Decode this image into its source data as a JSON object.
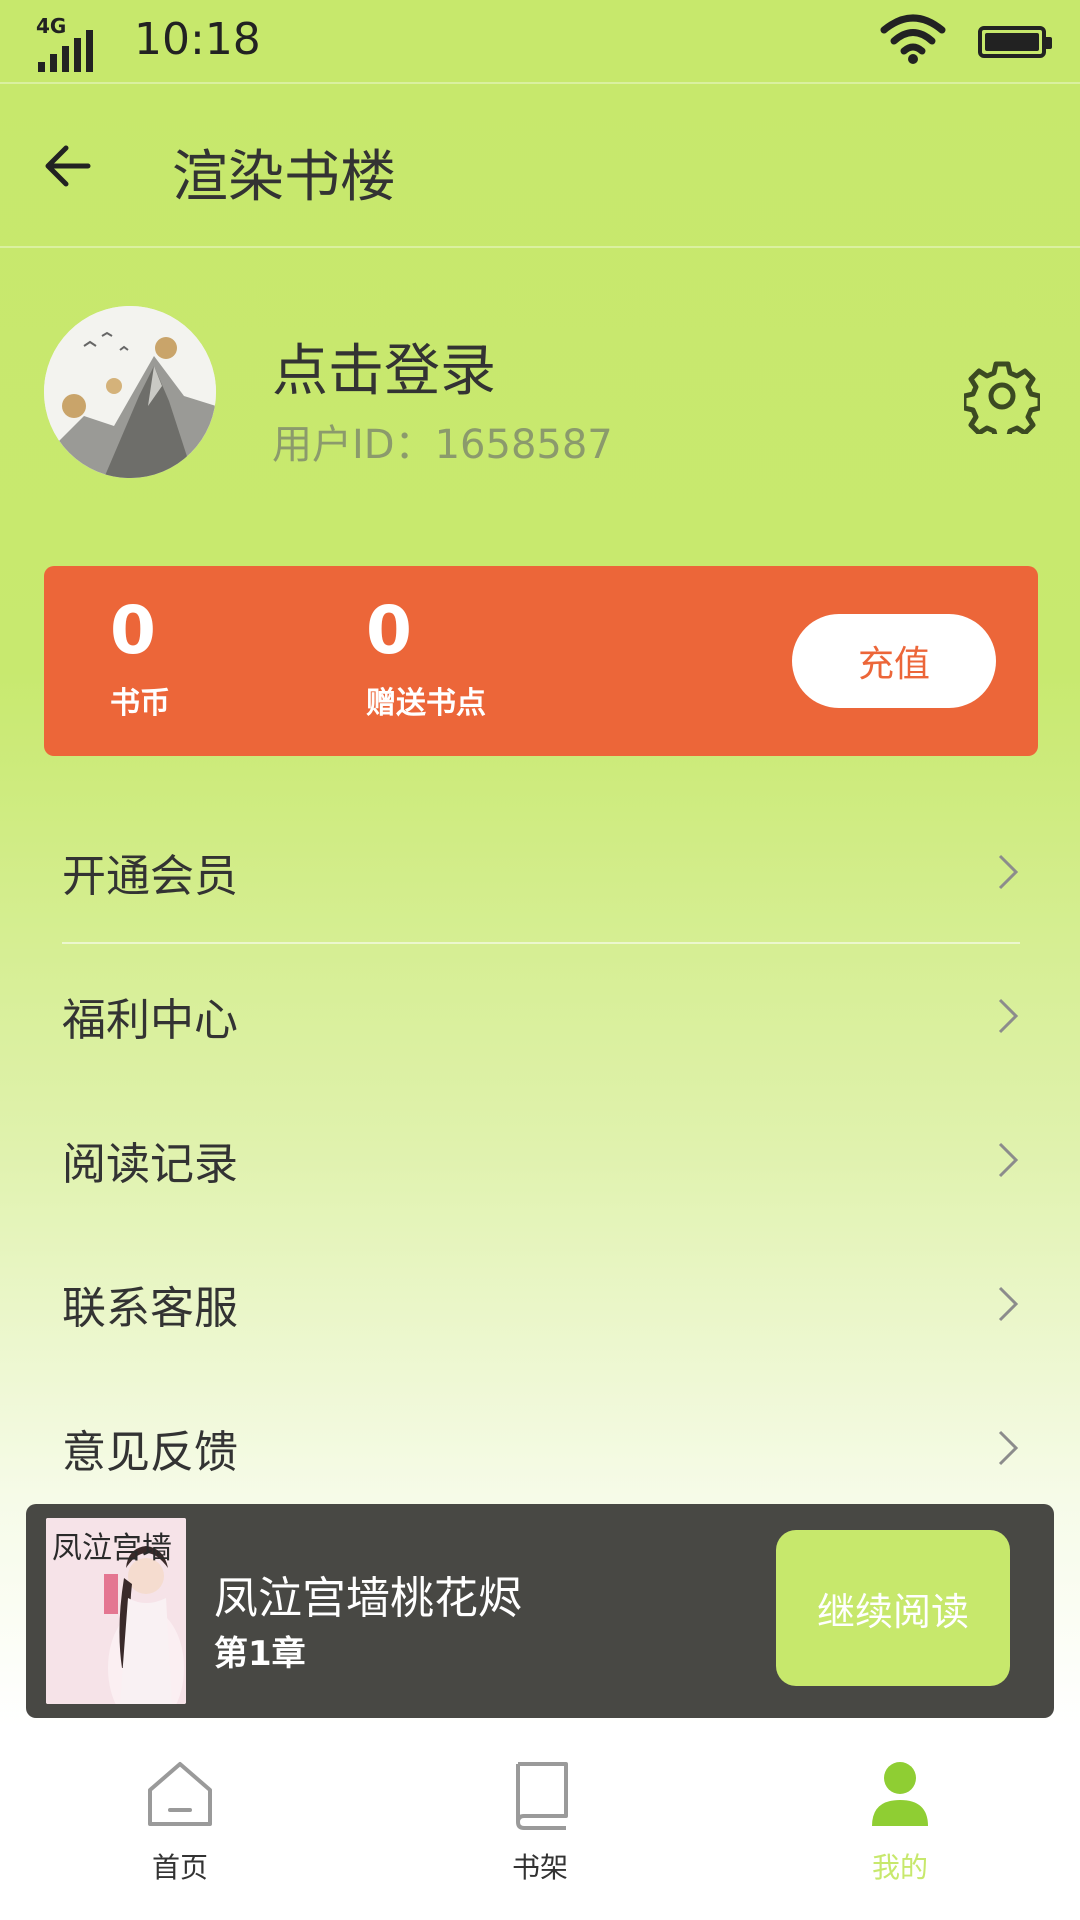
{
  "status_bar": {
    "network": "4G",
    "time": "10:18"
  },
  "header": {
    "title": "渲染书楼"
  },
  "profile": {
    "login_label": "点击登录",
    "user_id": "用户ID：1658587"
  },
  "balance": {
    "coins_value": "0",
    "coins_label": "书币",
    "bonus_value": "0",
    "bonus_label": "赠送书点",
    "recharge_label": "充值"
  },
  "menu": {
    "items": [
      {
        "label": "开通会员"
      },
      {
        "label": "福利中心"
      },
      {
        "label": "阅读记录"
      },
      {
        "label": "联系客服"
      },
      {
        "label": "意见反馈"
      }
    ]
  },
  "continue_reading": {
    "book_title": "凤泣宫墙桃花烬",
    "chapter": "第1章",
    "cover_text": "凤泣宫墙",
    "button_label": "继续阅读"
  },
  "nav": {
    "items": [
      {
        "label": "首页",
        "icon": "home-icon"
      },
      {
        "label": "书架",
        "icon": "bookshelf-icon"
      },
      {
        "label": "我的",
        "icon": "profile-icon"
      }
    ],
    "active_index": 2
  },
  "colors": {
    "accent_green": "#c7e86c",
    "card_orange": "#ec6639",
    "dark_bar": "#484844"
  }
}
